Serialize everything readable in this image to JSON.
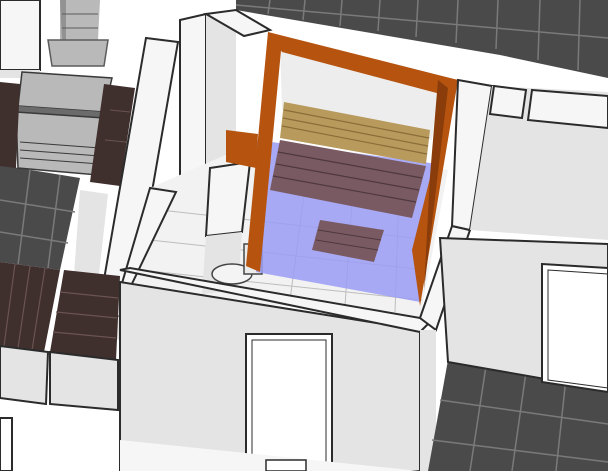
{
  "view": {
    "kind": "3d-floor-plan-isometric",
    "selection_color": "#9a9cf5"
  },
  "colors": {
    "dark_floor": "#4a4a4a",
    "dark_floor_grout": "#7a7a7a",
    "light_floor": "#f2f2f2",
    "light_floor_grout": "#bdbdbd",
    "wall_top": "#f6f6f6",
    "wall_face": "#e4e4e4",
    "wall_edge": "#2b2b2b",
    "sauna_wood": "#b5530f",
    "sauna_wood_dark": "#8a3d0a",
    "bench": "#7a5a62",
    "backrest": "#b79a5c",
    "deck_wood": "#3f2f2d",
    "stove_body": "#b9b9b9",
    "stove_dark": "#6b6b6b"
  },
  "objects": [
    {
      "name": "sauna-room",
      "material": "wood"
    },
    {
      "name": "sauna-upper-bench",
      "material": "wood-slats"
    },
    {
      "name": "sauna-backrest",
      "material": "wood"
    },
    {
      "name": "sauna-floor-grate",
      "material": "wood"
    },
    {
      "name": "shower-cabinet",
      "material": "white"
    },
    {
      "name": "toilet",
      "material": "ceramic"
    },
    {
      "name": "kitchen-stove",
      "material": "steel"
    },
    {
      "name": "range-hood",
      "material": "steel"
    },
    {
      "name": "kitchen-counter",
      "material": "white"
    },
    {
      "name": "wooden-deck",
      "material": "dark-wood"
    },
    {
      "name": "door-front",
      "material": "white"
    },
    {
      "name": "door-right",
      "material": "white"
    },
    {
      "name": "door-left-edge",
      "material": "white"
    }
  ]
}
